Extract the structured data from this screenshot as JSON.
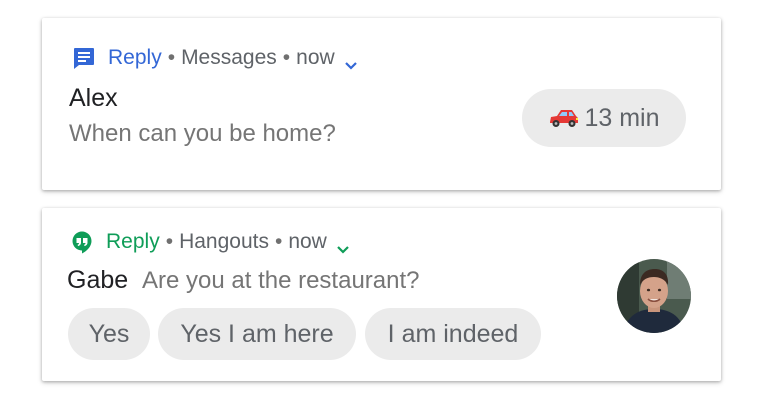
{
  "notification_1": {
    "app_color": "#3367d6",
    "icon": "messages-icon",
    "action": "Reply",
    "app_name": "Messages",
    "time": "now",
    "sender": "Alex",
    "message": "When can you be home?",
    "chip": {
      "icon": "car-icon",
      "label": "13 min"
    }
  },
  "notification_2": {
    "app_color": "#0f9d58",
    "icon": "hangouts-icon",
    "action": "Reply",
    "app_name": "Hangouts",
    "time": "now",
    "sender": "Gabe",
    "message": "Are you at the restaurant?",
    "avatar": "avatar-photo",
    "smart_replies": [
      "Yes",
      "Yes I am here",
      "I am indeed"
    ]
  }
}
